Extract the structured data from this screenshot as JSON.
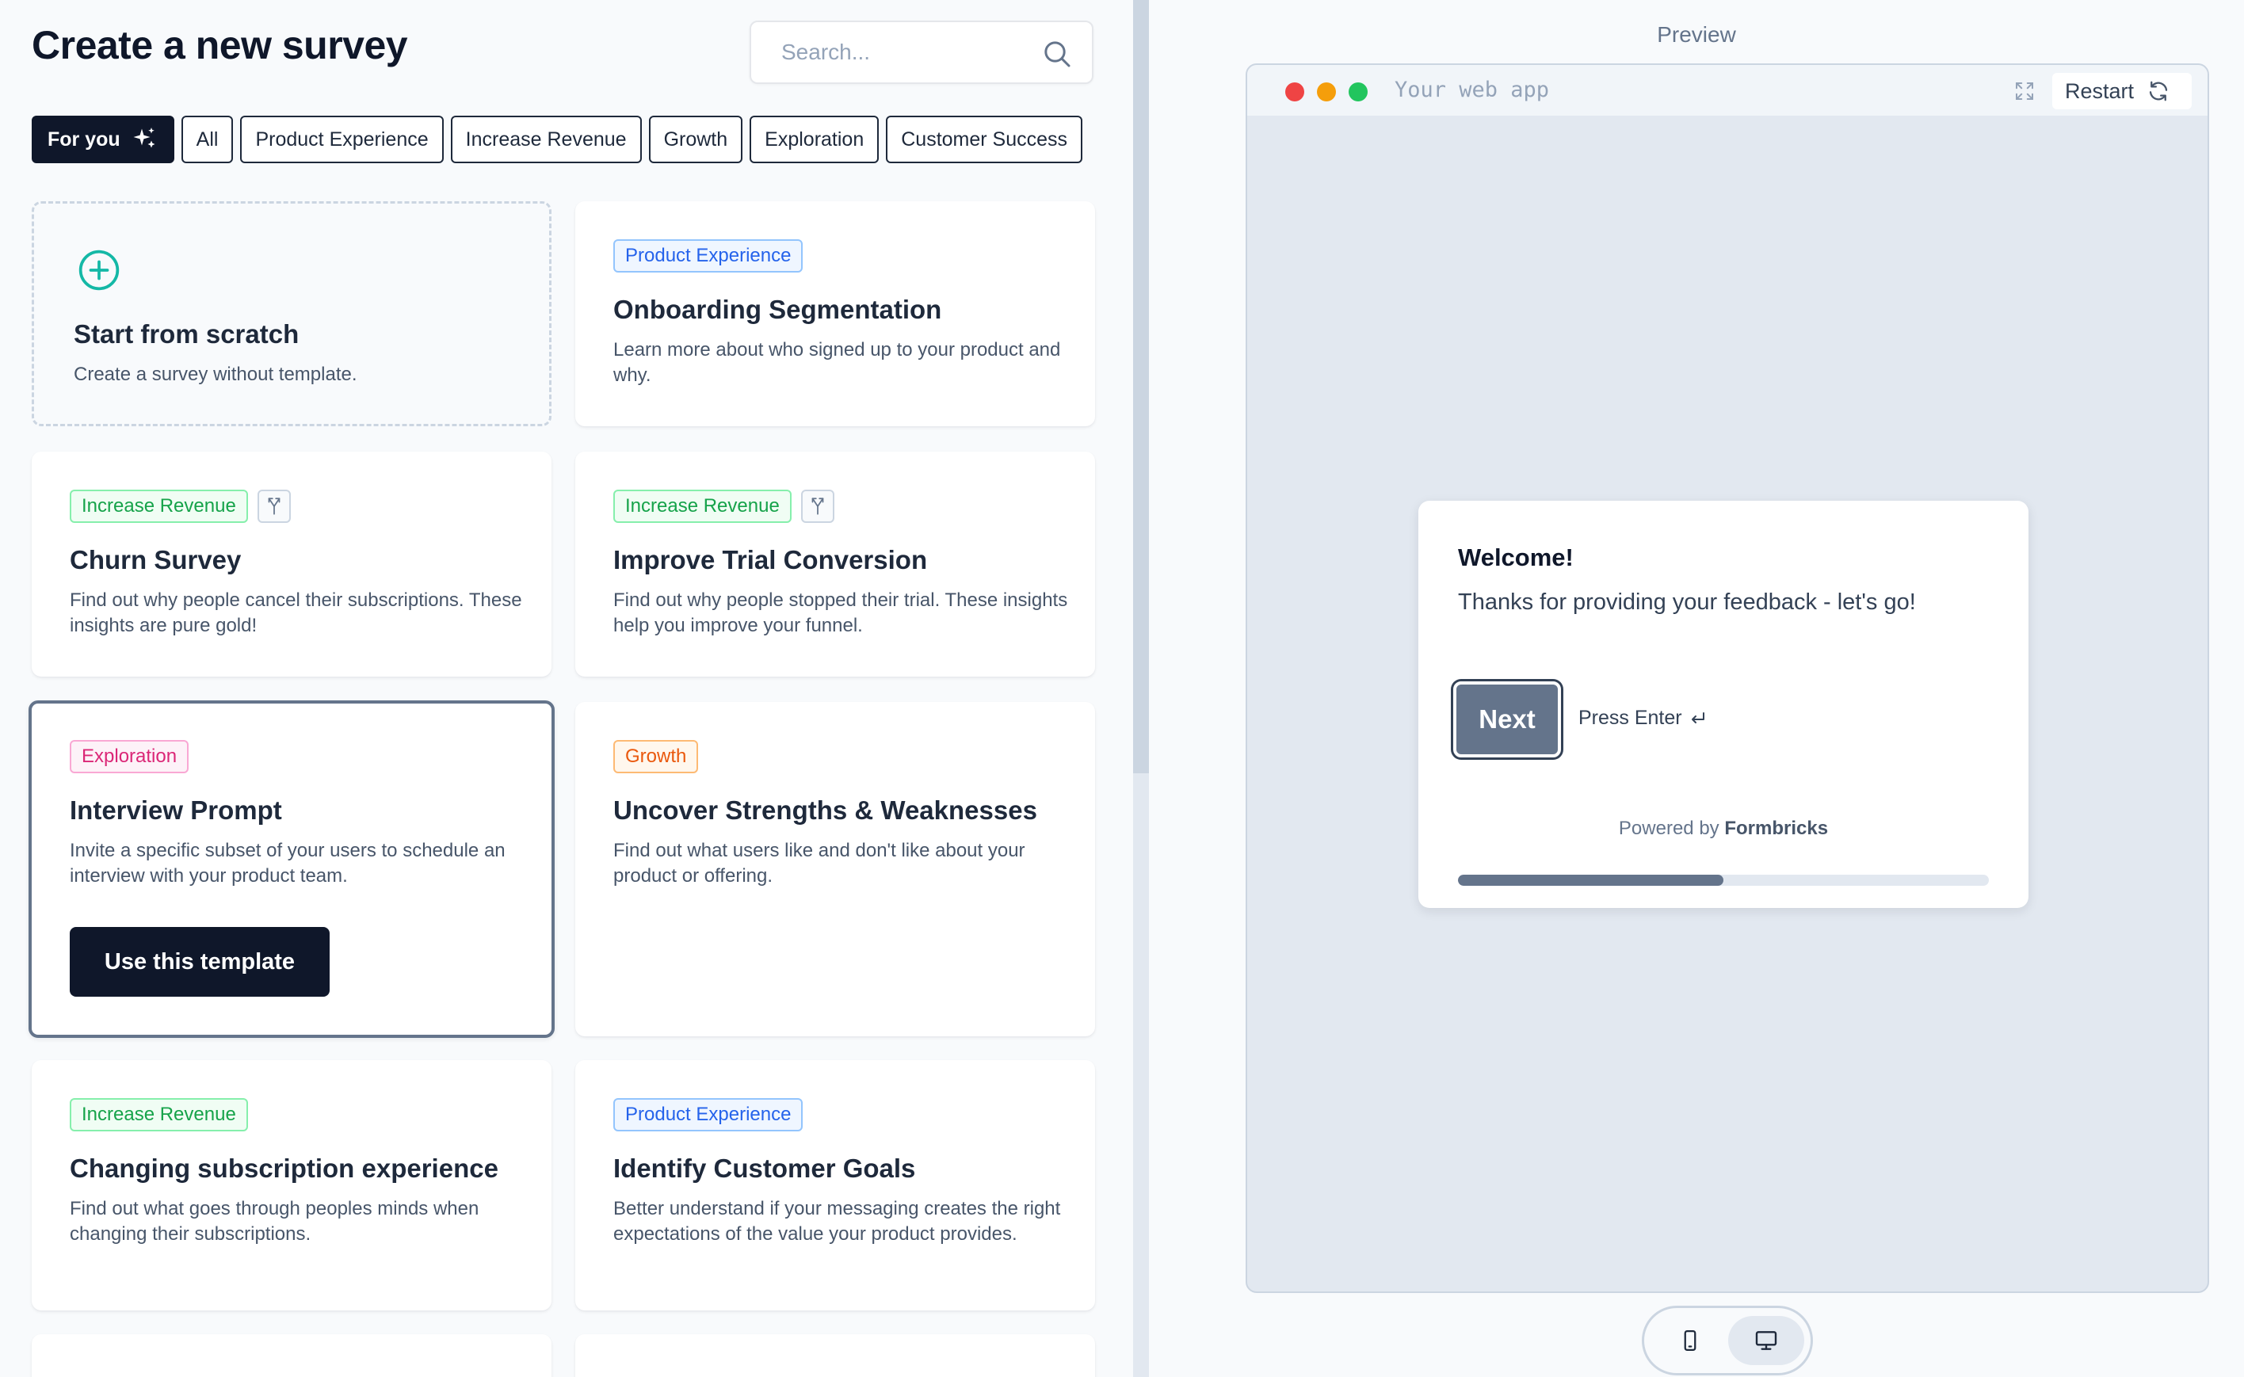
{
  "header": {
    "title": "Create a new survey",
    "search_placeholder": "Search..."
  },
  "filters": [
    {
      "label": "For you",
      "active": true
    },
    {
      "label": "All"
    },
    {
      "label": "Product Experience"
    },
    {
      "label": "Increase Revenue"
    },
    {
      "label": "Growth"
    },
    {
      "label": "Exploration"
    },
    {
      "label": "Customer Success"
    }
  ],
  "scratch": {
    "title": "Start from scratch",
    "description": "Create a survey without template."
  },
  "templates": [
    {
      "tag": "Product Experience",
      "title": "Onboarding Segmentation",
      "description": "Learn more about who signed up to your product and why."
    },
    {
      "tag": "Increase Revenue",
      "title": "Churn Survey",
      "description": "Find out why people cancel their subscriptions. These insights are pure gold!"
    },
    {
      "tag": "Increase Revenue",
      "title": "Improve Trial Conversion",
      "description": "Find out why people stopped their trial. These insights help you improve your funnel."
    },
    {
      "tag": "Exploration",
      "title": "Interview Prompt",
      "description": "Invite a specific subset of your users to schedule an interview with your product team."
    },
    {
      "tag": "Growth",
      "title": "Uncover Strengths & Weaknesses",
      "description": "Find out what users like and don't like about your product or offering."
    },
    {
      "tag": "Increase Revenue",
      "title": "Changing subscription experience",
      "description": "Find out what goes through peoples minds when changing their subscriptions."
    },
    {
      "tag": "Product Experience",
      "title": "Identify Customer Goals",
      "description": "Better understand if your messaging creates the right expectations of the value your product provides."
    }
  ],
  "selected_template_button": "Use this template",
  "preview": {
    "label": "Preview",
    "app_name": "Your web app",
    "restart_label": "Restart",
    "survey": {
      "welcome": "Welcome!",
      "message": "Thanks for providing your feedback - let's go!",
      "next_label": "Next",
      "press_enter": "Press Enter",
      "powered_prefix": "Powered by",
      "powered_brand": "Formbricks",
      "progress": 0.5
    }
  },
  "colors": {
    "primary": "#0f172a",
    "brand_accent": "#14b8a6",
    "tag_product_experience": "#2563eb",
    "tag_increase_revenue": "#16a34a",
    "tag_exploration": "#db2777",
    "tag_growth": "#ea580c"
  }
}
